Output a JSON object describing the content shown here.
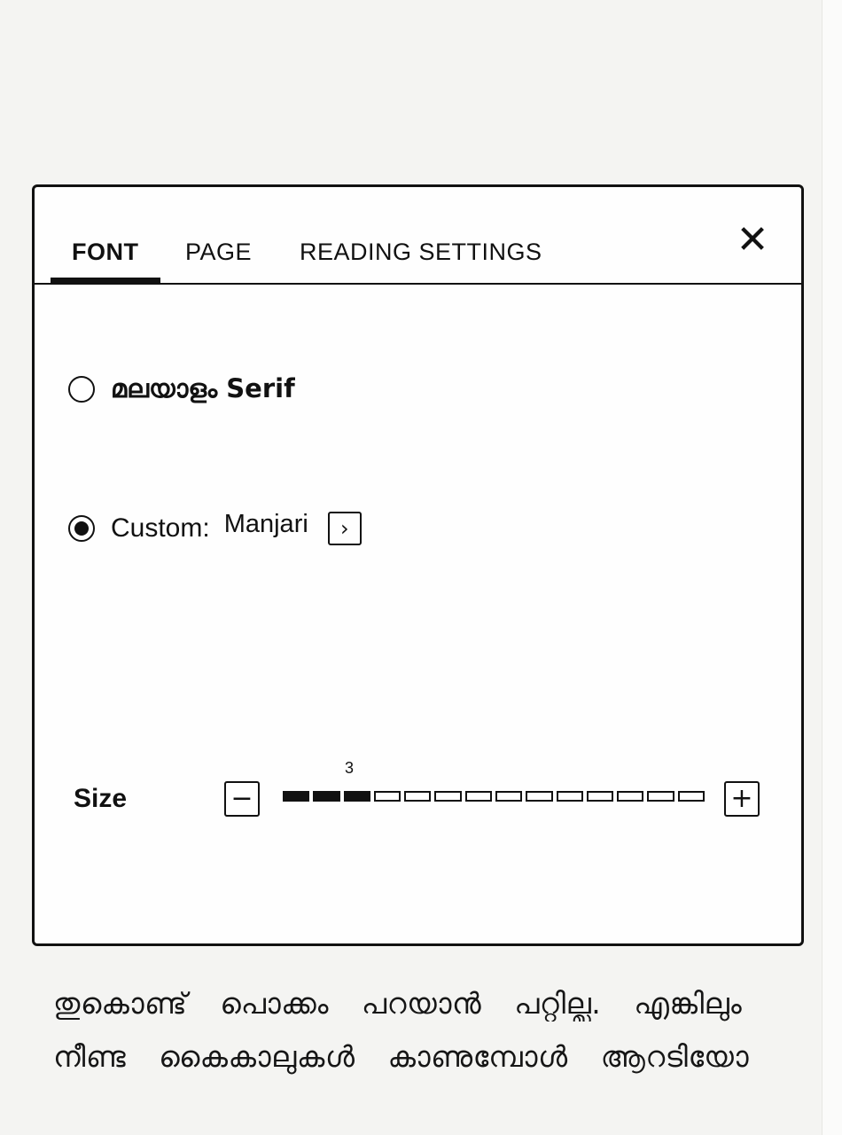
{
  "tabs": [
    {
      "label": "FONT",
      "active": true
    },
    {
      "label": "PAGE",
      "active": false
    },
    {
      "label": "READING SETTINGS",
      "active": false
    }
  ],
  "close_glyph": "✕",
  "fonts": {
    "option1": {
      "label": "മലയാളം Serif",
      "selected": false
    },
    "option2": {
      "label": "Custom:",
      "value": "Manjari",
      "selected": true
    },
    "chevron_glyph": "›"
  },
  "size": {
    "label": "Size",
    "value": "3",
    "level": 3,
    "max_level": 14,
    "minus_glyph": "−",
    "plus_glyph": "+"
  },
  "book": {
    "line1": "തുകൊണ്ട് പൊക്കം പറയാൻ പറ്റില്ല. എങ്കിലും",
    "line2": "നീണ്ട കൈകാലുകൾ കാണുമ്പോൾ ആറടിയോ"
  }
}
